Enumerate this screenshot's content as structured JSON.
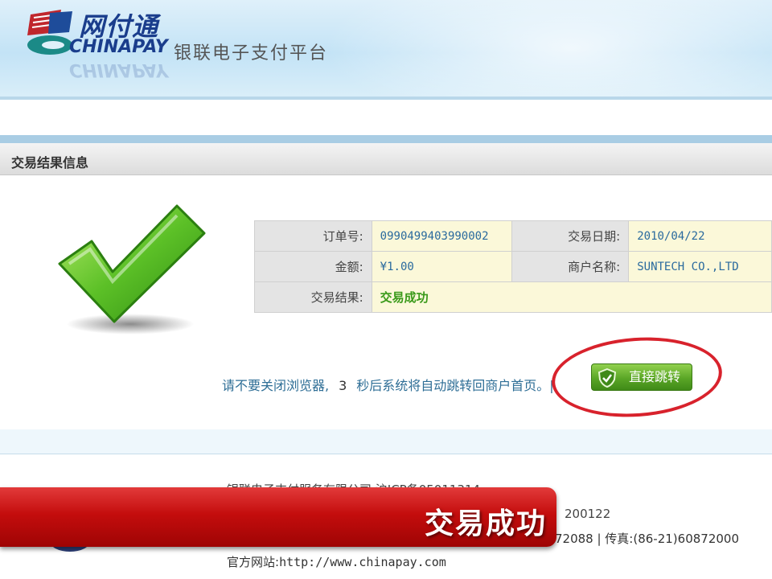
{
  "header": {
    "logo_cn": "网付通",
    "logo_en": "CHINAPAY",
    "platform_title": "银联电子支付平台"
  },
  "section": {
    "title": "交易结果信息"
  },
  "transaction": {
    "order_no_label": "订单号:",
    "order_no": "0990499403990002",
    "date_label": "交易日期:",
    "date": "2010/04/22",
    "amount_label": "金额:",
    "amount": "¥1.00",
    "merchant_label": "商户名称:",
    "merchant": "SUNTECH CO.,LTD",
    "result_label": "交易结果:",
    "result": "交易成功"
  },
  "redirect": {
    "text_before": "请不要关闭浏览器,",
    "seconds": "3",
    "text_after": "秒后系统将自动跳转回商户首页。|",
    "button_label": "直接跳转"
  },
  "footer": {
    "company": "银联电子支付服务有限公司  沪ICP备05011314",
    "zip": "200122",
    "phone": "72088 | 传真:(86-21)60872000",
    "site_label": "官方网站:",
    "site_url": "http://www.chinapay.com"
  },
  "banner": {
    "text": "交易成功"
  },
  "colors": {
    "accent_blue": "#1a3d8c",
    "success_green": "#3a9a1a",
    "banner_red": "#c40d0d",
    "highlight_circle": "#d8222c"
  }
}
